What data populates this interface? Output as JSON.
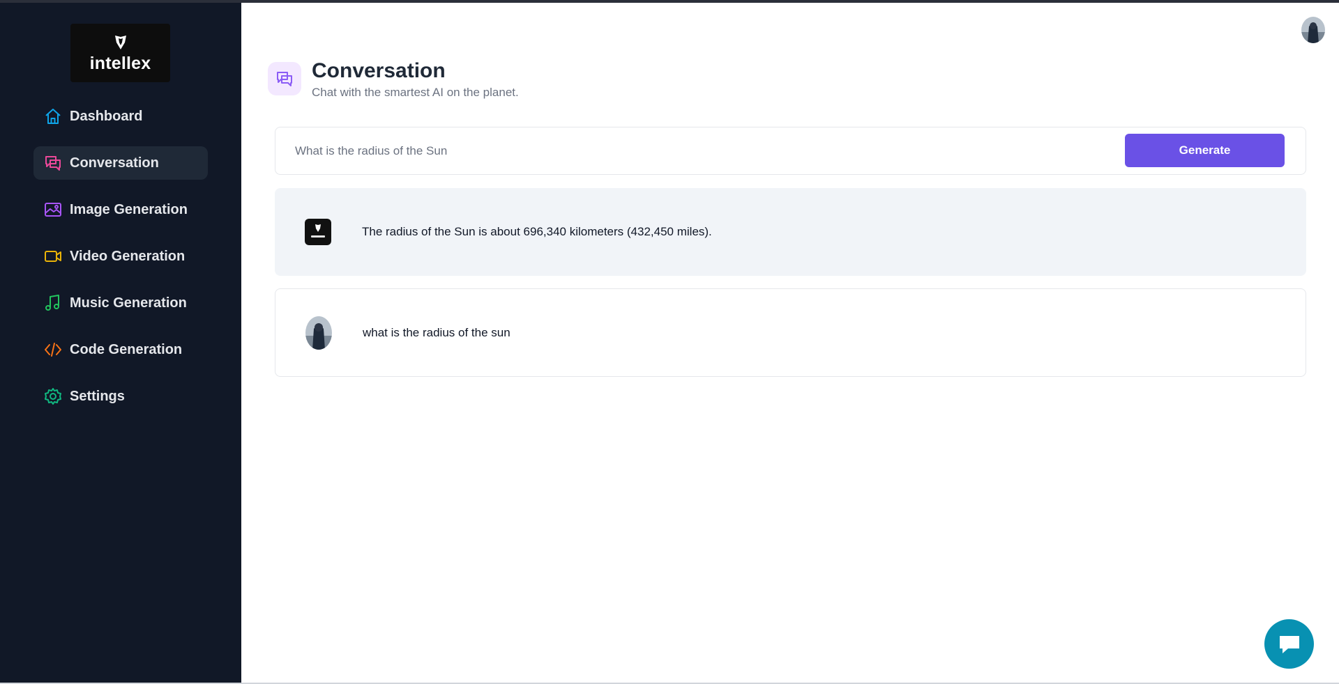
{
  "brand": {
    "name": "intellex"
  },
  "sidebar": {
    "items": [
      {
        "label": "Dashboard",
        "icon": "home-icon",
        "color": "#0ea5e9"
      },
      {
        "label": "Conversation",
        "icon": "chat-icon",
        "color": "#ec4899",
        "active": true
      },
      {
        "label": "Image Generation",
        "icon": "image-icon",
        "color": "#a855f7"
      },
      {
        "label": "Video Generation",
        "icon": "video-icon",
        "color": "#eab308"
      },
      {
        "label": "Music Generation",
        "icon": "music-icon",
        "color": "#22c55e"
      },
      {
        "label": "Code Generation",
        "icon": "code-icon",
        "color": "#f97316"
      },
      {
        "label": "Settings",
        "icon": "gear-icon",
        "color": "#10b981"
      }
    ]
  },
  "header": {
    "title": "Conversation",
    "subtitle": "Chat with the smartest AI on the planet.",
    "icon": "chat-icon",
    "icon_color": "#8b5cf6"
  },
  "prompt": {
    "placeholder": "What is the radius of the Sun",
    "generate_label": "Generate"
  },
  "messages": [
    {
      "role": "bot",
      "text": "The radius of the Sun is about 696,340 kilometers (432,450 miles)."
    },
    {
      "role": "user",
      "text": "what is the radius of the sun"
    }
  ],
  "colors": {
    "sidebar_bg": "#111827",
    "accent": "#6a51e6",
    "support_fab": "#0891b2"
  }
}
